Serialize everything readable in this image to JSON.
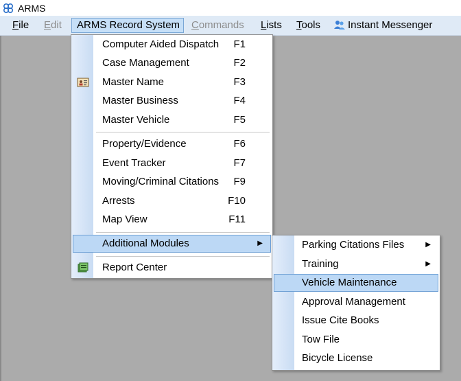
{
  "window": {
    "title": "ARMS"
  },
  "menubar": {
    "items": [
      {
        "label": "File",
        "underline": "F",
        "rest": "ile",
        "state": "normal"
      },
      {
        "label": "Edit",
        "underline": "E",
        "rest": "dit",
        "state": "disabled"
      },
      {
        "label": "ARMS Record System",
        "state": "open"
      },
      {
        "label": "Commands",
        "underline": "C",
        "rest": "ommands",
        "state": "disabled"
      },
      {
        "label": "Lists",
        "underline": "L",
        "rest": "ists",
        "state": "normal"
      },
      {
        "label": "Tools",
        "underline": "T",
        "rest": "ools",
        "state": "normal"
      },
      {
        "label": "Instant Messenger",
        "state": "normal",
        "icon": "messenger-icon"
      }
    ]
  },
  "arms_menu": {
    "items": [
      {
        "label": "Computer Aided Dispatch",
        "shortcut": "F1"
      },
      {
        "label": "Case Management",
        "shortcut": "F2"
      },
      {
        "label": "Master Name",
        "shortcut": "F3",
        "icon": "id-card-icon"
      },
      {
        "label": "Master Business",
        "shortcut": "F4"
      },
      {
        "label": "Master Vehicle",
        "shortcut": "F5"
      },
      {
        "label": "Property/Evidence",
        "shortcut": "F6"
      },
      {
        "label": "Event Tracker",
        "shortcut": "F7"
      },
      {
        "label": "Moving/Criminal Citations",
        "shortcut": "F9"
      },
      {
        "label": "Arrests",
        "shortcut": "F10"
      },
      {
        "label": "Map View",
        "shortcut": "F11"
      },
      {
        "label": "Additional Modules",
        "submenu": true,
        "highlighted": true
      },
      {
        "label": "Report Center",
        "icon": "report-center-icon"
      }
    ]
  },
  "additional_modules_menu": {
    "items": [
      {
        "label": "Parking Citations Files",
        "submenu": true
      },
      {
        "label": "Training",
        "submenu": true
      },
      {
        "label": "Vehicle Maintenance",
        "highlighted": true
      },
      {
        "label": "Approval Management"
      },
      {
        "label": "Issue Cite Books"
      },
      {
        "label": "Tow File"
      },
      {
        "label": "Bicycle License"
      }
    ]
  },
  "colors": {
    "menubar_bg": "#dfeaf6",
    "highlight_bg": "#bcd8f5",
    "highlight_border": "#6d9fd4",
    "workspace_bg": "#ababab"
  }
}
